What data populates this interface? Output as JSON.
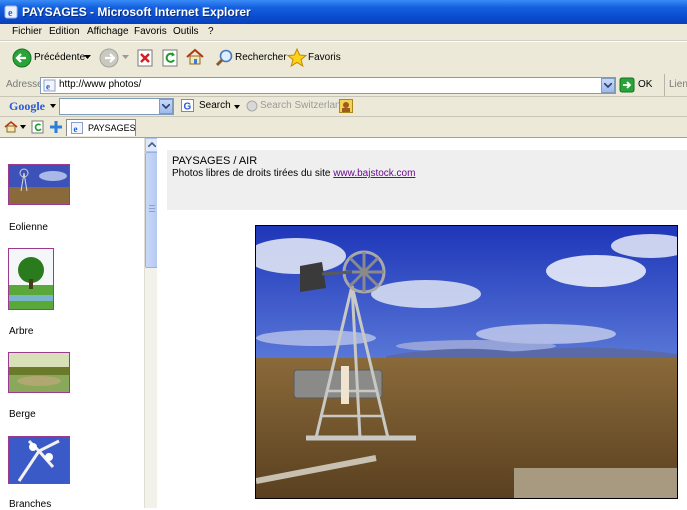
{
  "window": {
    "title": "PAYSAGES - Microsoft Internet Explorer"
  },
  "menu": [
    "Fichier",
    "Edition",
    "Affichage",
    "Favoris",
    "Outils",
    "?"
  ],
  "toolbar": {
    "back_label": "Précédente",
    "search_label": "Rechercher",
    "favorites_label": "Favoris"
  },
  "address": {
    "label": "Adresse",
    "url": "http://www photos/",
    "go_label": "OK",
    "links_label": "Liens"
  },
  "google": {
    "logo": "Google",
    "search_label": "Search",
    "switzerland_label": "Search Switzerland"
  },
  "tabs": [
    {
      "label": "PAYSAGES"
    }
  ],
  "sidebar": {
    "items": [
      {
        "label": "Eolienne"
      },
      {
        "label": "Arbre"
      },
      {
        "label": "Berge"
      },
      {
        "label": "Branches"
      }
    ]
  },
  "content": {
    "title": "PAYSAGES / AIR",
    "subtitle_prefix": "Photos libres de droits tirées du site ",
    "link_text": "www.bajstock.com"
  },
  "colors": {
    "titlebar": "#0a4cd0",
    "chrome": "#ece9d8",
    "link": "#6b0b8f",
    "thumb_border": "#9b3b8f"
  }
}
